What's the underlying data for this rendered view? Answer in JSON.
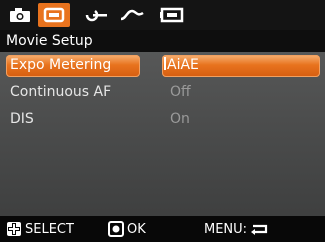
{
  "tabs": [
    {
      "icon": "camera-icon"
    },
    {
      "icon": "movie-icon",
      "active": true
    },
    {
      "icon": "wrench-icon"
    },
    {
      "icon": "wave-icon"
    },
    {
      "icon": "playback-icon"
    }
  ],
  "title": "Movie Setup",
  "menu": {
    "items": [
      {
        "label": "Expo Metering",
        "value": "AiAE",
        "selected": true
      },
      {
        "label": "Continuous AF",
        "value": "Off"
      },
      {
        "label": "DIS",
        "value": "On"
      }
    ]
  },
  "footer": {
    "select_label": "SELECT",
    "ok_label": "OK",
    "menu_label": "MENU:"
  },
  "colors": {
    "accent": "#e8731e",
    "background": "#4f5050",
    "bars": "#111111"
  }
}
